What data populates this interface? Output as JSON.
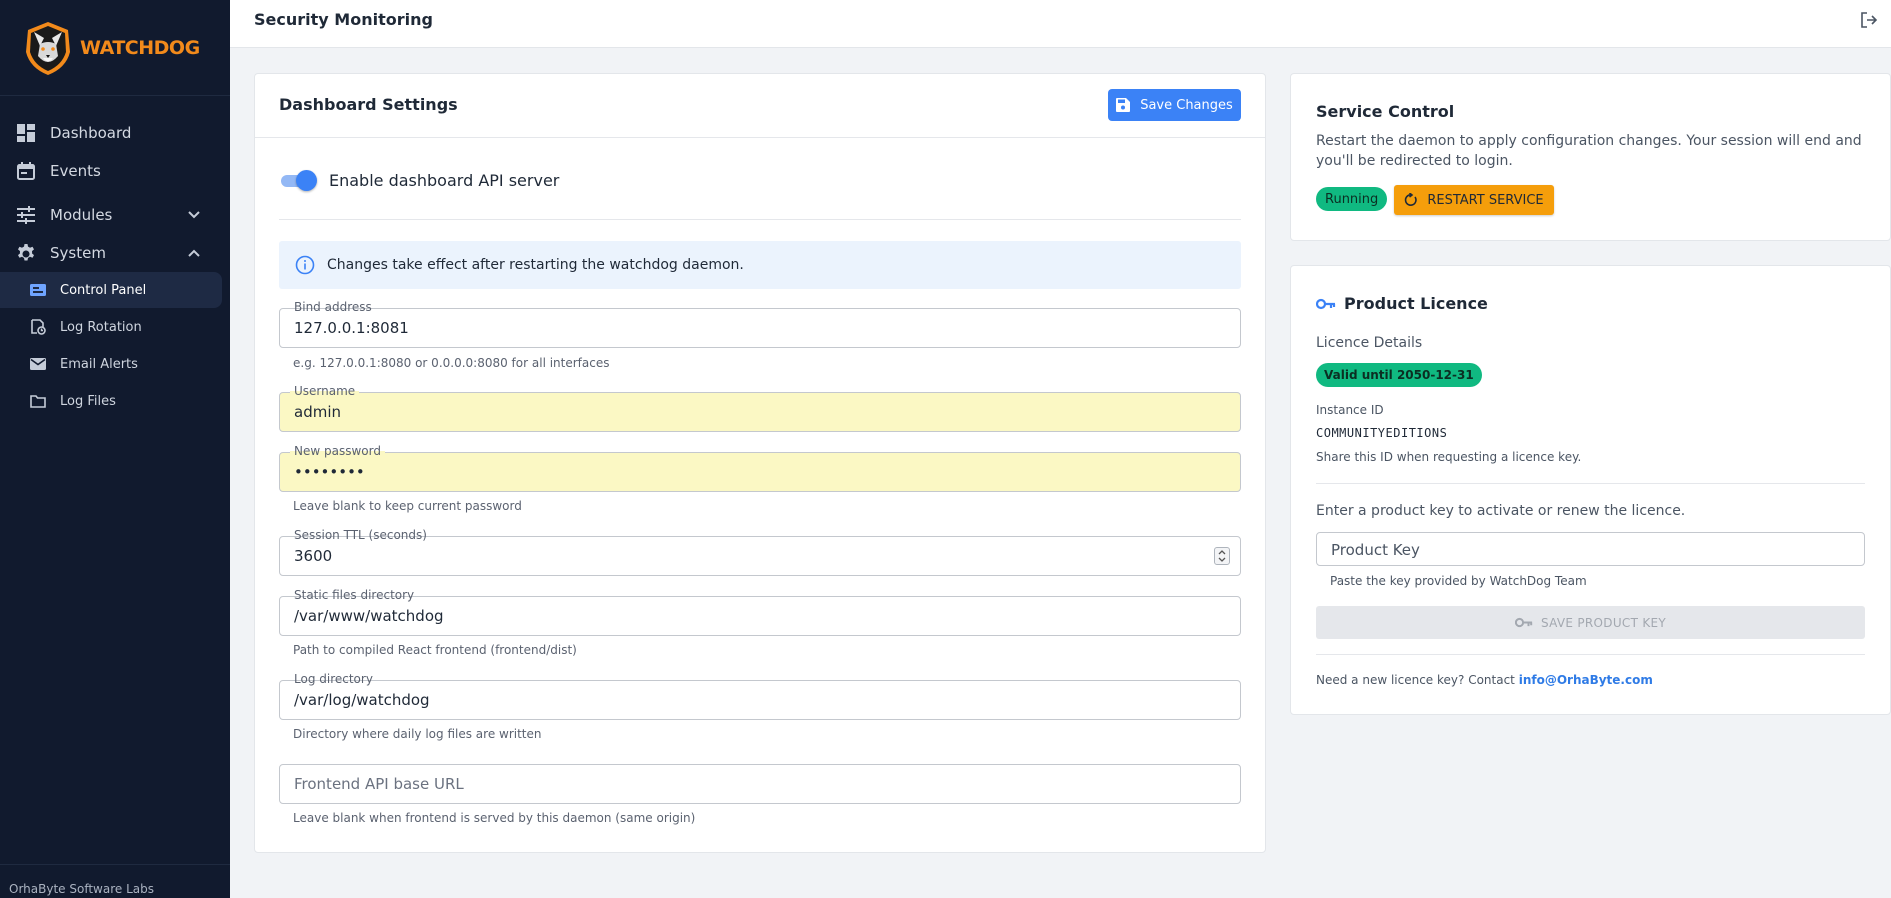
{
  "brand": {
    "logo_text": "WATCHDOG",
    "footer": "OrhaByte Software Labs"
  },
  "sidebar": {
    "items": [
      {
        "label": "Dashboard",
        "icon": "dashboard-icon"
      },
      {
        "label": "Events",
        "icon": "calendar-icon"
      },
      {
        "label": "Modules",
        "icon": "sliders-icon",
        "expanded": false
      },
      {
        "label": "System",
        "icon": "gear-icon",
        "expanded": true
      }
    ],
    "subitems": [
      {
        "label": "Control Panel",
        "icon": "control-panel-icon",
        "active": true
      },
      {
        "label": "Log Rotation",
        "icon": "log-rotation-icon",
        "active": false
      },
      {
        "label": "Email Alerts",
        "icon": "mail-icon",
        "active": false
      },
      {
        "label": "Log Files",
        "icon": "folder-icon",
        "active": false
      }
    ]
  },
  "header": {
    "title": "Security Monitoring"
  },
  "settings": {
    "title": "Dashboard Settings",
    "save_label": "Save Changes",
    "toggle_label": "Enable dashboard API server",
    "toggle_on": true,
    "alert": "Changes take effect after restarting the watchdog daemon.",
    "fields": {
      "bind": {
        "label": "Bind address",
        "value": "127.0.0.1:8081",
        "hint": "e.g. 127.0.0.1:8080 or 0.0.0.0:8080 for all interfaces"
      },
      "username": {
        "label": "Username",
        "value": "admin"
      },
      "password": {
        "label": "New password",
        "value": "••••••••",
        "hint": "Leave blank to keep current password"
      },
      "ttl": {
        "label": "Session TTL (seconds)",
        "value": "3600"
      },
      "static": {
        "label": "Static files directory",
        "value": "/var/www/watchdog",
        "hint": "Path to compiled React frontend (frontend/dist)"
      },
      "logdir": {
        "label": "Log directory",
        "value": "/var/log/watchdog",
        "hint": "Directory where daily log files are written"
      },
      "apibase": {
        "placeholder": "Frontend API base URL",
        "hint": "Leave blank when frontend is served by this daemon (same origin)"
      }
    }
  },
  "service": {
    "title": "Service Control",
    "description": "Restart the daemon to apply configuration changes. Your session will end and you'll be redirected to login.",
    "status": "Running",
    "restart_label": "RESTART SERVICE"
  },
  "licence": {
    "title": "Product Licence",
    "details_label": "Licence Details",
    "valid_badge": "Valid until 2050-12-31",
    "instance_label": "Instance ID",
    "instance_id": "COMMUNITYEDITIONS",
    "instance_hint": "Share this ID when requesting a licence key.",
    "activate_text": "Enter a product key to activate or renew the licence.",
    "key_placeholder": "Product Key",
    "key_hint": "Paste the key provided by WatchDog Team",
    "save_key_label": "SAVE PRODUCT KEY",
    "contact_text": "Need a new licence key? Contact ",
    "contact_email": "info@OrhaByte.com"
  },
  "colors": {
    "sidebar_bg": "#111a2e",
    "primary": "#3b82f6",
    "success": "#10b981",
    "warning": "#f59e0b",
    "brand_orange": "#f28a1b"
  }
}
